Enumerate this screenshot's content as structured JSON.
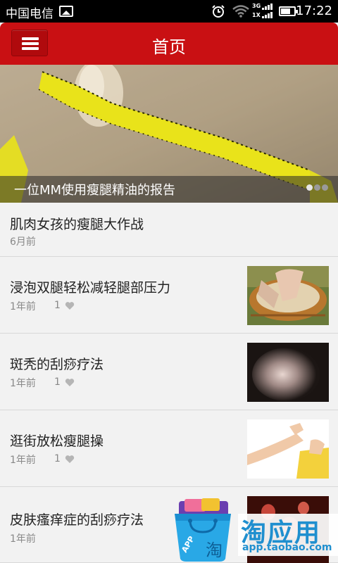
{
  "status_bar": {
    "carrier": "中国电信",
    "network_top": "3G",
    "network_bottom": "1X",
    "battery_level": 0.7,
    "time": "17:22"
  },
  "header": {
    "menu_icon": "hamburger-menu-icon",
    "title": "首页"
  },
  "banner": {
    "caption": "一位MM使用瘦腿精油的报告",
    "slide_count": 3,
    "active_slide": 1
  },
  "articles": [
    {
      "title": "肌肉女孩的瘦腿大作战",
      "time": "6月前",
      "likes": "",
      "has_thumb": false
    },
    {
      "title": "浸泡双腿轻松减轻腿部压力",
      "time": "1年前",
      "likes": "1",
      "has_thumb": true
    },
    {
      "title": "斑秃的刮痧疗法",
      "time": "1年前",
      "likes": "1",
      "has_thumb": true
    },
    {
      "title": "逛街放松瘦腿操",
      "time": "1年前",
      "likes": "1",
      "has_thumb": true
    },
    {
      "title": "皮肤瘙痒症的刮痧疗法",
      "time": "1年前",
      "likes": "",
      "has_thumb": true
    }
  ],
  "promo": {
    "brand": "淘应用",
    "url": "app.taobao.com",
    "bag_label": "APP",
    "bag_char": "淘"
  },
  "colors": {
    "header_red": "#c91013",
    "list_bg": "#f2f2f2",
    "taobao_blue": "#1f8fcf"
  }
}
